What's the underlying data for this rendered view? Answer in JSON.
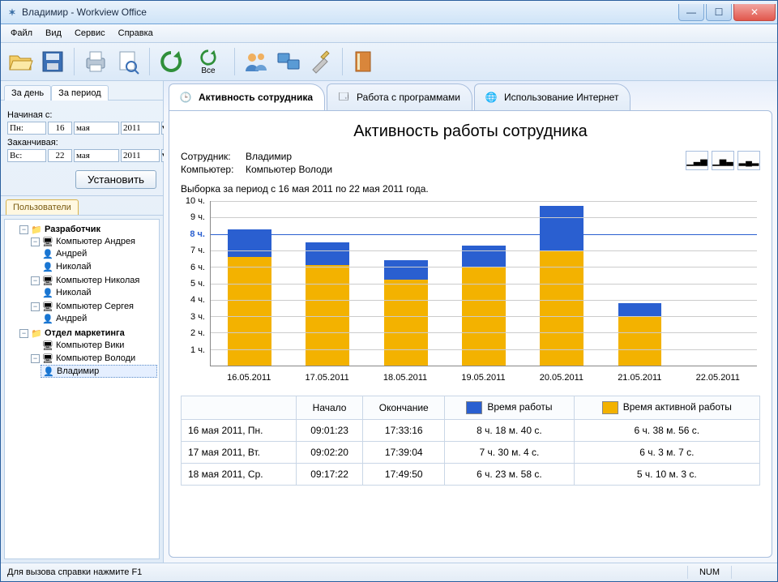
{
  "window": {
    "title": "Владимир - Workview Office"
  },
  "menu": {
    "file": "Файл",
    "view": "Вид",
    "service": "Сервис",
    "help": "Справка"
  },
  "toolbar": {
    "all_label": "Все"
  },
  "sidebar": {
    "tabs": {
      "day": "За день",
      "period": "За период"
    },
    "from_label": "Начиная с:",
    "to_label": "Заканчивая:",
    "from": {
      "dow": "Пн:",
      "d": "16",
      "m": "мая",
      "y": "2011"
    },
    "to": {
      "dow": "Вс:",
      "d": "22",
      "m": "мая",
      "y": "2011"
    },
    "set_btn": "Установить",
    "users_tab": "Пользователи",
    "tree": {
      "dev": "Разработчик",
      "pc_andrey": "Компьютер Андрея",
      "u_andrey": "Андрей",
      "u_nikolay": "Николай",
      "pc_nikolay": "Компьютер Николая",
      "u_nikolay2": "Николай",
      "pc_sergey": "Компьютер Сергея",
      "u_andrey2": "Андрей",
      "marketing": "Отдел маркетинга",
      "pc_viki": "Компьютер Вики",
      "pc_volodya": "Компьютер Володи",
      "u_vladimir": "Владимир"
    }
  },
  "main_tabs": {
    "activity": "Активность сотрудника",
    "programs": "Работа с программами",
    "internet": "Использование Интернет"
  },
  "report": {
    "title": "Активность работы сотрудника",
    "emp_label": "Сотрудник:",
    "emp_value": "Владимир",
    "pc_label": "Компьютер:",
    "pc_value": "Компьютер Володи",
    "period_text": "Выборка за период с 16 мая 2011 по 22 мая 2011 года.",
    "table": {
      "h_start": "Начало",
      "h_end": "Окончание",
      "h_work": "Время работы",
      "h_active": "Время активной работы",
      "rows": [
        {
          "date": "16 мая 2011, Пн.",
          "start": "09:01:23",
          "end": "17:33:16",
          "work": "8 ч. 18 м. 40 с.",
          "active": "6 ч. 38 м. 56 с."
        },
        {
          "date": "17 мая 2011, Вт.",
          "start": "09:02:20",
          "end": "17:39:04",
          "work": "7 ч. 30 м.  4 с.",
          "active": "6 ч.  3 м.  7 с."
        },
        {
          "date": "18 мая 2011, Ср.",
          "start": "09:17:22",
          "end": "17:49:50",
          "work": "6 ч. 23 м. 58 с.",
          "active": "5 ч. 10 м.  3 с."
        }
      ]
    }
  },
  "chart_data": {
    "type": "bar",
    "title": "Активность работы сотрудника",
    "ylabel": "ч.",
    "ylim": [
      0,
      10
    ],
    "reference_line": 8,
    "categories": [
      "16.05.2011",
      "17.05.2011",
      "18.05.2011",
      "19.05.2011",
      "20.05.2011",
      "21.05.2011",
      "22.05.2011"
    ],
    "series": [
      {
        "name": "Время работы",
        "color": "#2a5fd0",
        "values": [
          8.3,
          7.5,
          6.4,
          7.3,
          9.7,
          3.8,
          0
        ]
      },
      {
        "name": "Время активной работы",
        "color": "#f3b200",
        "values": [
          6.6,
          6.1,
          5.2,
          6.0,
          7.0,
          3.0,
          0
        ]
      }
    ],
    "yticks": [
      "1 ч.",
      "2 ч.",
      "3 ч.",
      "4 ч.",
      "5 ч.",
      "6 ч.",
      "7 ч.",
      "8 ч.",
      "9 ч.",
      "10 ч."
    ]
  },
  "statusbar": {
    "hint": "Для вызова справки нажмите F1",
    "num": "NUM"
  }
}
